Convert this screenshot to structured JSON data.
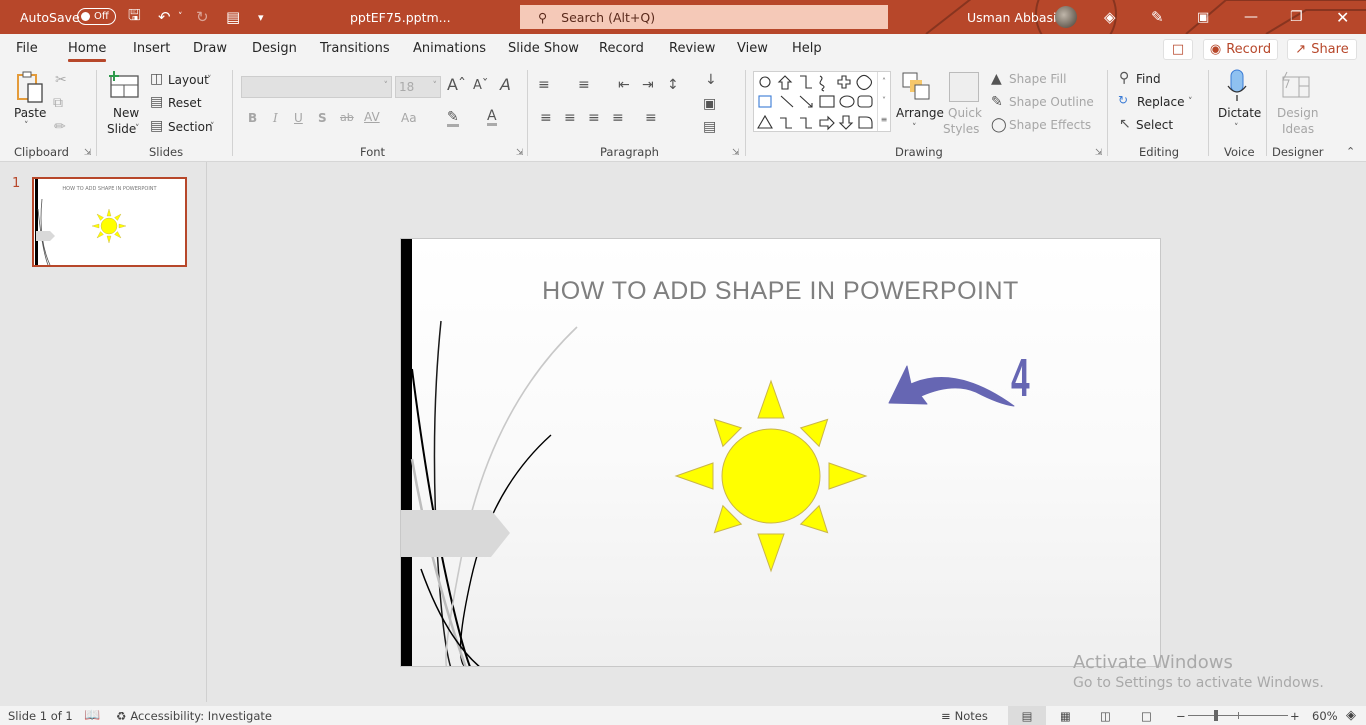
{
  "titlebar": {
    "autosave_label": "AutoSave",
    "autosave_state": "Off",
    "filename": "pptEF75.pptm...",
    "search_placeholder": "Search (Alt+Q)",
    "user_name": "Usman Abbasi",
    "icons": [
      "save-icon",
      "undo-icon",
      "redo-icon",
      "present-from-start-icon",
      "customize-qat-icon",
      "premium-diamond-icon",
      "pen-icon",
      "ribbon-display-icon",
      "minimize-icon",
      "restore-icon",
      "close-icon"
    ]
  },
  "menu": {
    "tabs": [
      "File",
      "Home",
      "Insert",
      "Draw",
      "Design",
      "Transitions",
      "Animations",
      "Slide Show",
      "Record",
      "Review",
      "View",
      "Help"
    ],
    "active_tab": "Home",
    "record_label": "Record",
    "share_label": "Share"
  },
  "ribbon": {
    "clipboard": {
      "label": "Clipboard",
      "paste": "Paste"
    },
    "slides": {
      "label": "Slides",
      "new_slide_1": "New",
      "new_slide_2": "Slide",
      "layout": "Layout",
      "reset": "Reset",
      "section": "Section"
    },
    "font": {
      "label": "Font",
      "font_name": "",
      "font_size": "18",
      "bold": "B",
      "italic": "I",
      "underline": "U",
      "shadow": "S",
      "strike": "ab",
      "spacing": "AV",
      "case": "Aa"
    },
    "paragraph": {
      "label": "Paragraph"
    },
    "drawing": {
      "label": "Drawing",
      "arrange": "Arrange",
      "quick_styles_1": "Quick",
      "quick_styles_2": "Styles",
      "shape_fill": "Shape Fill",
      "shape_outline": "Shape Outline",
      "shape_effects": "Shape Effects"
    },
    "editing": {
      "label": "Editing",
      "find": "Find",
      "replace": "Replace",
      "select": "Select"
    },
    "voice": {
      "label": "Voice",
      "dictate": "Dictate"
    },
    "designer": {
      "label": "Designer",
      "design_ideas_1": "Design",
      "design_ideas_2": "Ideas"
    }
  },
  "thumbnails": [
    {
      "number": "1",
      "title": "HOW TO ADD SHAPE IN POWERPOINT"
    }
  ],
  "slide": {
    "title": "HOW TO ADD  SHAPE IN POWERPOINT",
    "annotation_number": "4",
    "sun_color": "#ffff00",
    "sun_outline": "#c9b54a",
    "arrow_color": "#6666b3"
  },
  "watermark": {
    "line1": "Activate Windows",
    "line2": "Go to Settings to activate Windows."
  },
  "status": {
    "slide_info": "Slide 1 of 1",
    "accessibility": "Accessibility: Investigate",
    "notes": "Notes",
    "zoom": "60%",
    "zoom_fraction": 0.6
  },
  "colors": {
    "accent": "#b7472a"
  }
}
